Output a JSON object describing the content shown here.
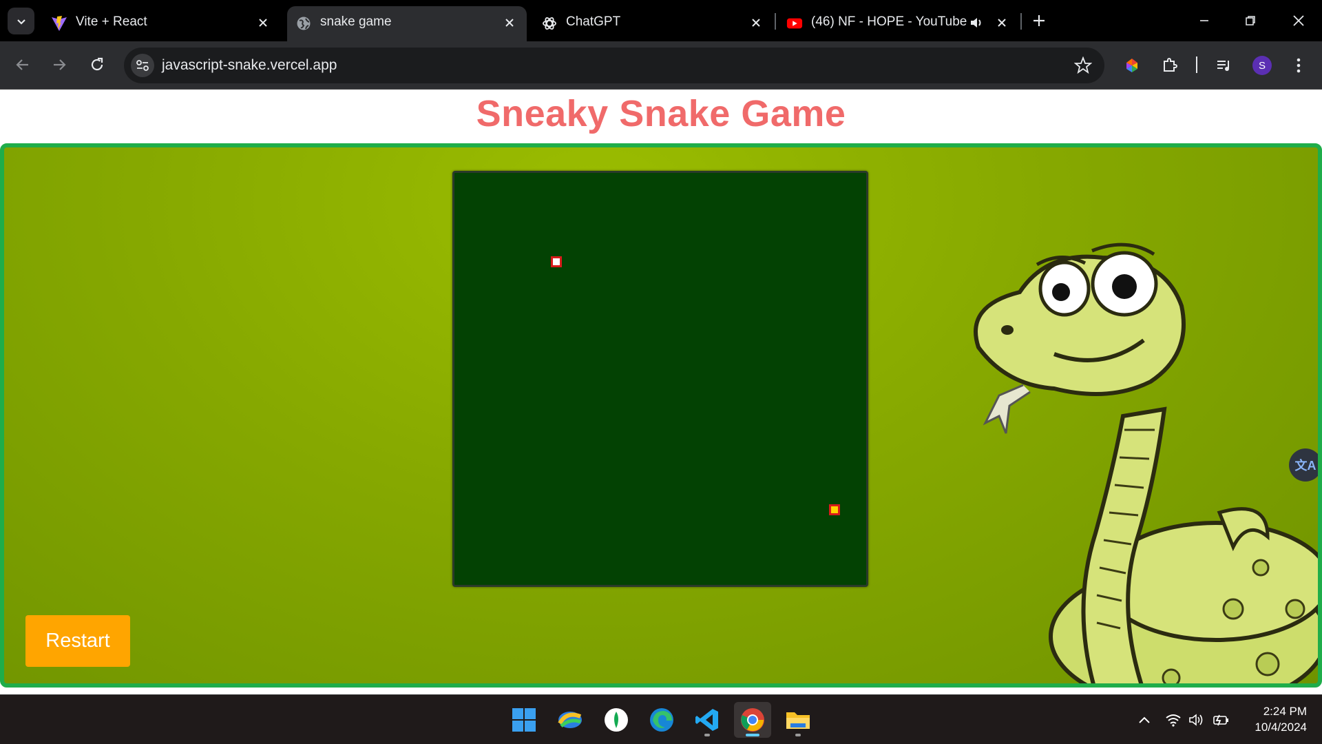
{
  "browser": {
    "tabs": [
      {
        "title": "Vite + React",
        "icon": "vite-icon",
        "active": false
      },
      {
        "title": "snake game",
        "icon": "globe-icon",
        "active": true
      },
      {
        "title": "ChatGPT",
        "icon": "chatgpt-icon",
        "active": false
      },
      {
        "title": "(46) NF - HOPE - YouTube",
        "icon": "youtube-icon",
        "active": false,
        "audio": true
      }
    ],
    "url": "javascript-snake.vercel.app",
    "profile_initial": "S"
  },
  "page": {
    "title": "Sneaky Snake Game",
    "restart_label": "Restart",
    "translate_glyph": "文A"
  },
  "game": {
    "snake_head": {
      "fill": "#ffffff",
      "border": "#d81b1b"
    },
    "food": {
      "fill": "#ffd400",
      "border": "#d81b1b"
    },
    "board_color": "#034203"
  },
  "taskbar": {
    "apps": [
      "windows-start-icon",
      "photos-icon",
      "mongodb-compass-icon",
      "edge-icon",
      "vscode-icon",
      "chrome-icon",
      "file-explorer-icon"
    ],
    "time": "2:24 PM",
    "date": "10/4/2024"
  },
  "colors": {
    "title": "#f06a6a",
    "frame_border": "#1fad4a",
    "restart_button": "#ffa500"
  }
}
